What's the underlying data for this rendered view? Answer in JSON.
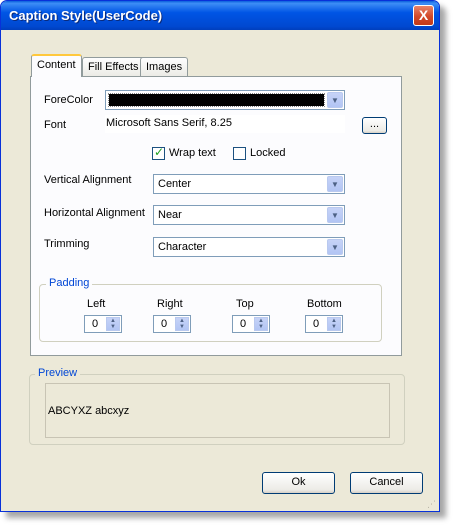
{
  "window": {
    "title": "Caption Style(UserCode)",
    "close_label": "X"
  },
  "tabs": [
    "Content",
    "Fill Effects",
    "Images"
  ],
  "content": {
    "forecolor_label": "ForeColor",
    "forecolor_value": "#000000",
    "font_label": "Font",
    "font_value": "Microsoft Sans Serif, 8.25",
    "font_button": "...",
    "wrap_text_label": "Wrap text",
    "wrap_text_checked": true,
    "locked_label": "Locked",
    "locked_checked": false,
    "vertical_alignment_label": "Vertical Alignment",
    "vertical_alignment_value": "Center",
    "horizontal_alignment_label": "Horizontal Alignment",
    "horizontal_alignment_value": "Near",
    "trimming_label": "Trimming",
    "trimming_value": "Character"
  },
  "padding": {
    "title": "Padding",
    "left_label": "Left",
    "left_value": "0",
    "right_label": "Right",
    "right_value": "0",
    "top_label": "Top",
    "top_value": "0",
    "bottom_label": "Bottom",
    "bottom_value": "0"
  },
  "preview": {
    "title": "Preview",
    "sample_text": "ABCYXZ abcxyz"
  },
  "buttons": {
    "ok": "Ok",
    "cancel": "Cancel"
  },
  "icons": {
    "dropdown": "chevron-down-icon",
    "spinner": "up-down-arrows-icon",
    "close": "close-icon"
  }
}
